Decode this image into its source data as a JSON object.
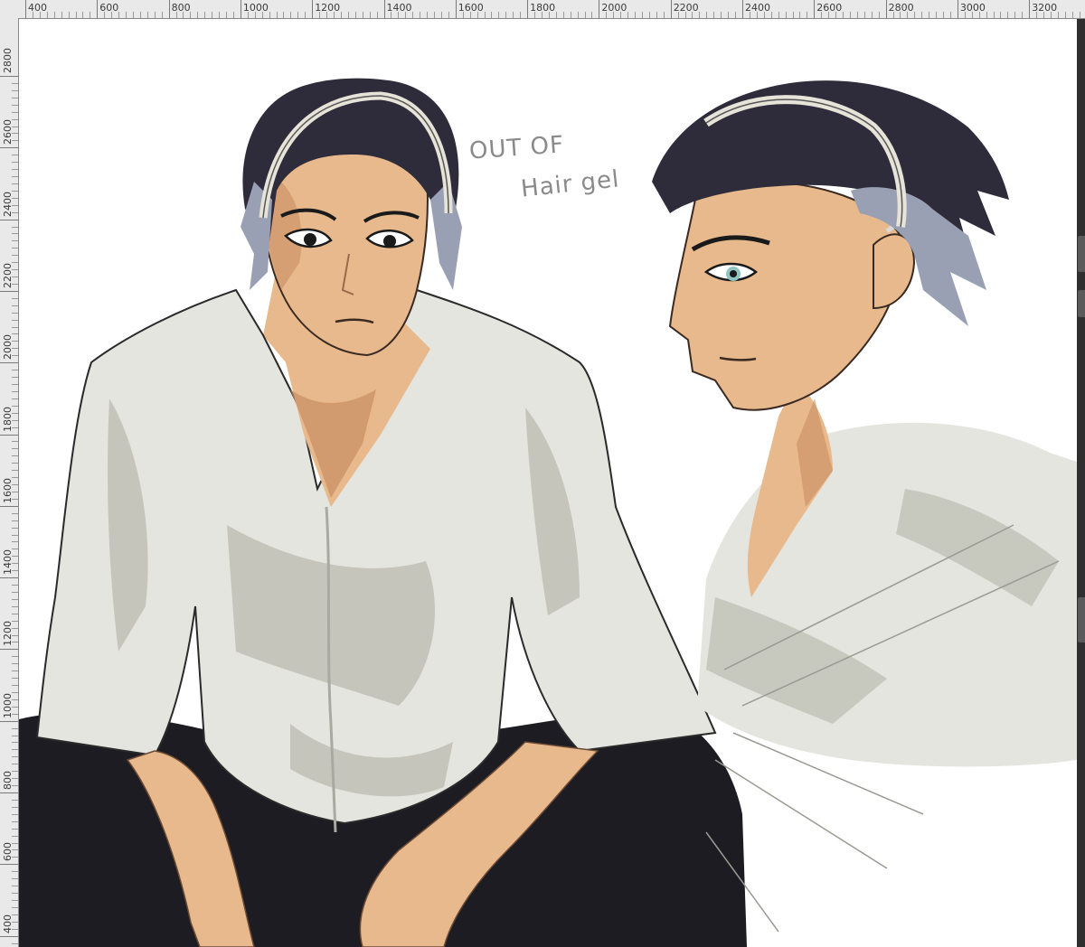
{
  "ruler": {
    "horizontal_labels": [
      "400",
      "600",
      "800",
      "1000",
      "1200",
      "1400",
      "1600",
      "1800",
      "2000",
      "2200",
      "2400",
      "2600",
      "2800",
      "3000",
      "3200"
    ],
    "vertical_labels": [
      "2800",
      "2600",
      "2400",
      "2200",
      "2000",
      "1800",
      "1600",
      "1400",
      "1200",
      "1000",
      "800",
      "600",
      "400"
    ]
  },
  "canvas": {
    "annotation_line1": "OUT OF",
    "annotation_line2": "Hair gel"
  },
  "colors": {
    "ruler_bg": "#e9e9e9",
    "workspace_bg": "#3d3d3d",
    "canvas_bg": "#ffffff",
    "hair": "#2e2b3a",
    "hair_highlight": "#9aa0b4",
    "skin": "#e8b98c",
    "skin_shadow": "#c98e62",
    "shirt": "#e4e5df",
    "shirt_shadow": "#bfc0b5",
    "pants": "#1d1c22",
    "headband": "#e6e4d8",
    "eyes": "#8fc4c0"
  },
  "icons": {
    "right_panel_buttons": [
      "panel-toggle-icon",
      "panel-toggle-icon",
      "panel-toggle-icon"
    ]
  }
}
